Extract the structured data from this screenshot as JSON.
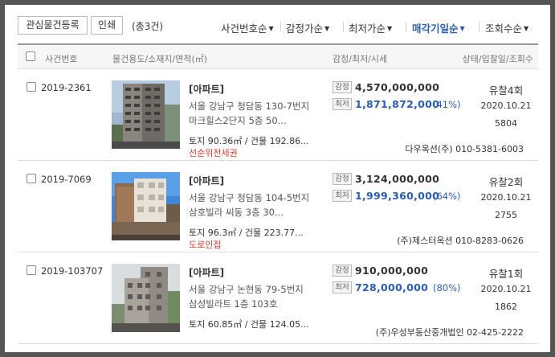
{
  "toolbar": {
    "register_label": "관심물건등록",
    "print_label": "인쇄",
    "count_text": "(총3건)",
    "sort_options": [
      {
        "label": "사건번호순",
        "active": false
      },
      {
        "label": "감정가순",
        "active": false
      },
      {
        "label": "최저가순",
        "active": false
      },
      {
        "label": "매각기일순",
        "active": true
      },
      {
        "label": "조회수순",
        "active": false
      }
    ]
  },
  "columns": {
    "case_no": "사건번호",
    "property": "물건용도/소재지/면적(㎡)",
    "price": "감정/최저/시세",
    "status": "상태/입찰일/조회수"
  },
  "labels": {
    "appraisal_tag": "감정",
    "minimum_tag": "최저"
  },
  "rows": [
    {
      "case_no": "2019-2361",
      "type": "[아파트]",
      "address_line1": "서울 강남구 청담동 130-7번지",
      "address_line2": "마크힐스2단지 5층 50...",
      "area": "토지 90.36㎡ / 건물 192.86...",
      "note": "선순위전세권",
      "appraisal": "4,570,000,000",
      "minimum": "1,871,872,000",
      "percent": "(41%)",
      "status": "유찰4회",
      "date": "2020.10.21",
      "views": "5804",
      "agent": "다우옥션(주) 010-5381-6003"
    },
    {
      "case_no": "2019-7069",
      "type": "[아파트]",
      "address_line1": "서울 강남구 청담동 104-5번지",
      "address_line2": "삼호빌라 씨동 3층 30...",
      "area": "토지 96.3㎡ / 건물 223.77...",
      "note": "도로인접",
      "appraisal": "3,124,000,000",
      "minimum": "1,999,360,000",
      "percent": "(64%)",
      "status": "유찰2회",
      "date": "2020.10.21",
      "views": "2755",
      "agent": "(주)제스터옥션 010-8283-0626"
    },
    {
      "case_no": "2019-103707",
      "type": "[아파트]",
      "address_line1": "서울 강남구 논현동 79-5번지",
      "address_line2": "삼성빌라트 1층 103호",
      "area": "토지 60.85㎡ / 건물 124.05...",
      "note": "",
      "appraisal": "910,000,000",
      "minimum": "728,000,000",
      "percent": "(80%)",
      "status": "유찰1회",
      "date": "2020.10.21",
      "views": "1862",
      "agent": "(주)우성부동산중개법인 02-425-2222"
    }
  ]
}
